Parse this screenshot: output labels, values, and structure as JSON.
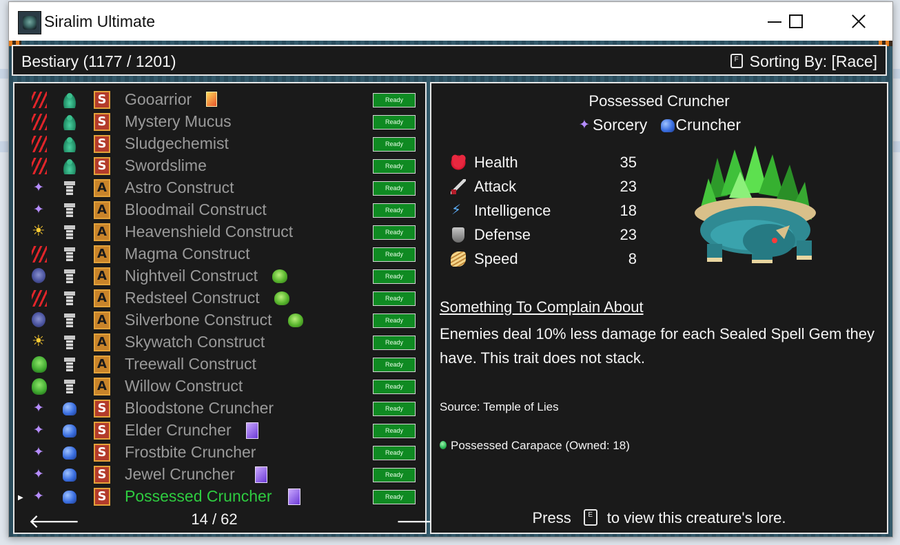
{
  "window": {
    "title": "Siralim Ultimate"
  },
  "header": {
    "title": "Bestiary (1177 / 1201)",
    "sort_key": "F",
    "sort_label": "Sorting By: [Race]"
  },
  "list": {
    "ready_label": "Ready",
    "page": "14 / 62",
    "items": [
      {
        "name": "Gooarrior",
        "klass": "claw",
        "race": "slime",
        "badge": "S",
        "extra": "card-red"
      },
      {
        "name": "Mystery Mucus",
        "klass": "claw",
        "race": "slime",
        "badge": "S",
        "extra": ""
      },
      {
        "name": "Sludgechemist",
        "klass": "claw",
        "race": "slime",
        "badge": "S",
        "extra": ""
      },
      {
        "name": "Swordslime",
        "klass": "claw",
        "race": "slime",
        "badge": "S",
        "extra": ""
      },
      {
        "name": "Astro Construct",
        "klass": "sorc",
        "race": "constr",
        "badge": "A",
        "extra": ""
      },
      {
        "name": "Bloodmail Construct",
        "klass": "sorc",
        "race": "constr",
        "badge": "A",
        "extra": ""
      },
      {
        "name": "Heavenshield Construct",
        "klass": "sun",
        "race": "constr",
        "badge": "A",
        "extra": ""
      },
      {
        "name": "Magma Construct",
        "klass": "claw",
        "race": "constr",
        "badge": "A",
        "extra": ""
      },
      {
        "name": "Nightveil Construct",
        "klass": "skull",
        "race": "constr",
        "badge": "A",
        "extra": "blob"
      },
      {
        "name": "Redsteel Construct",
        "klass": "claw",
        "race": "constr",
        "badge": "A",
        "extra": "blob"
      },
      {
        "name": "Silverbone Construct",
        "klass": "skull",
        "race": "constr",
        "badge": "A",
        "extra": "blob"
      },
      {
        "name": "Skywatch Construct",
        "klass": "sun",
        "race": "constr",
        "badge": "A",
        "extra": ""
      },
      {
        "name": "Treewall Construct",
        "klass": "leaf",
        "race": "constr",
        "badge": "A",
        "extra": ""
      },
      {
        "name": "Willow Construct",
        "klass": "leaf",
        "race": "constr",
        "badge": "A",
        "extra": ""
      },
      {
        "name": "Bloodstone Cruncher",
        "klass": "sorc",
        "race": "crunch",
        "badge": "S",
        "extra": ""
      },
      {
        "name": "Elder Cruncher",
        "klass": "sorc",
        "race": "crunch",
        "badge": "S",
        "extra": "card-purple"
      },
      {
        "name": "Frostbite Cruncher",
        "klass": "sorc",
        "race": "crunch",
        "badge": "S",
        "extra": ""
      },
      {
        "name": "Jewel Cruncher",
        "klass": "sorc",
        "race": "crunch",
        "badge": "S",
        "extra": "card-purple"
      },
      {
        "name": "Possessed Cruncher",
        "klass": "sorc",
        "race": "crunch",
        "badge": "S",
        "extra": "card-purple",
        "selected": true
      }
    ]
  },
  "detail": {
    "name": "Possessed Cruncher",
    "klass": "Sorcery",
    "race": "Cruncher",
    "stats": [
      {
        "label": "Health",
        "value": "35",
        "icon": "heart"
      },
      {
        "label": "Attack",
        "value": "23",
        "icon": "sword"
      },
      {
        "label": "Intelligence",
        "value": "18",
        "icon": "bolt"
      },
      {
        "label": "Defense",
        "value": "23",
        "icon": "shield"
      },
      {
        "label": "Speed",
        "value": "8",
        "icon": "wing"
      }
    ],
    "trait_title": "Something To Complain About",
    "trait_desc": "Enemies deal 10% less damage for each Sealed Spell Gem they have. This trait does not stack.",
    "source": "Source: Temple of Lies",
    "material": "Possessed Carapace (Owned: 18)",
    "lore_press": "Press",
    "lore_key": "E",
    "lore_rest": "to view this creature's lore."
  },
  "colors": {
    "selected": "#2ecc40",
    "unselected": "#9a9a9a",
    "ready_bg": "#0f8a22"
  }
}
